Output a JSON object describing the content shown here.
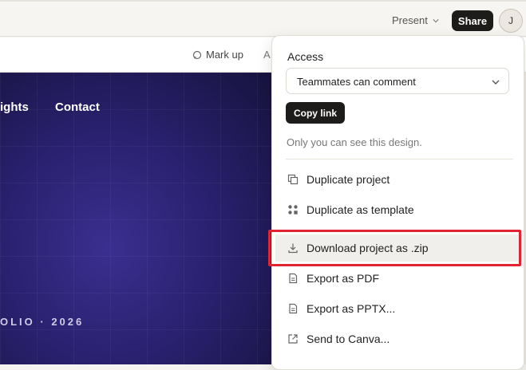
{
  "topbar": {
    "present_label": "Present",
    "share_label": "Share",
    "avatar_initial": "J"
  },
  "toolbar": {
    "markup_label": "Mark up",
    "cut_label": "A"
  },
  "canvas": {
    "nav": [
      "ights",
      "Contact"
    ],
    "portfolio_text": "OLIO · 2026"
  },
  "share_menu": {
    "access_label": "Access",
    "access_value": "Teammates can comment",
    "copy_link_label": "Copy link",
    "visibility_note": "Only you can see this design.",
    "items": [
      {
        "label": "Duplicate project",
        "icon": "duplicate-icon"
      },
      {
        "label": "Duplicate as template",
        "icon": "template-icon"
      },
      {
        "label": "Download project as .zip",
        "icon": "download-icon"
      },
      {
        "label": "Export as PDF",
        "icon": "document-icon"
      },
      {
        "label": "Export as PPTX...",
        "icon": "document-icon"
      },
      {
        "label": "Send to Canva...",
        "icon": "external-link-icon"
      }
    ]
  },
  "colors": {
    "highlight_box": "#e02433",
    "dark_button": "#1d1c1a",
    "canvas_gradient": "#2a2170"
  }
}
